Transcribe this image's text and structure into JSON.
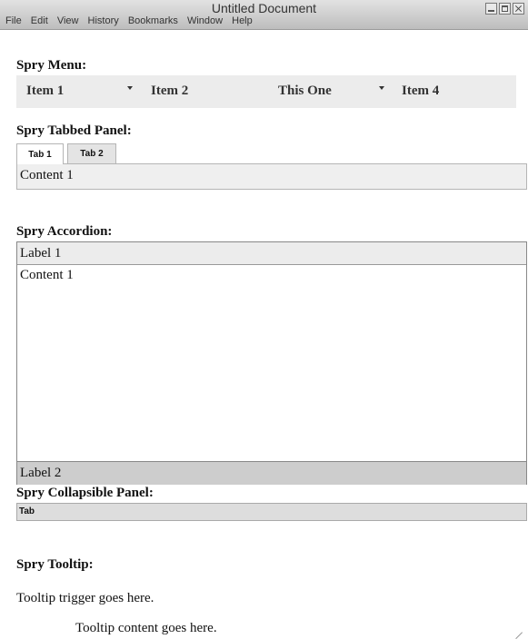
{
  "window": {
    "title": "Untitled Document",
    "menu": [
      "File",
      "Edit",
      "View",
      "History",
      "Bookmarks",
      "Window",
      "Help"
    ]
  },
  "spry_menu": {
    "heading": "Spry Menu:",
    "items": [
      "Item 1",
      "Item 2",
      "This One",
      "Item 4"
    ]
  },
  "tabbed_panel": {
    "heading": "Spry Tabbed Panel:",
    "tabs": [
      "Tab 1",
      "Tab 2"
    ],
    "content": "Content 1"
  },
  "accordion": {
    "heading": "Spry Accordion:",
    "label1": "Label 1",
    "content1": "Content 1",
    "label2": "Label 2"
  },
  "collapsible_panel": {
    "heading": "Spry Collapsible Panel:",
    "tab": "Tab"
  },
  "tooltip": {
    "heading": "Spry Tooltip:",
    "trigger": "Tooltip trigger goes here.",
    "content": "Tooltip content goes here."
  }
}
